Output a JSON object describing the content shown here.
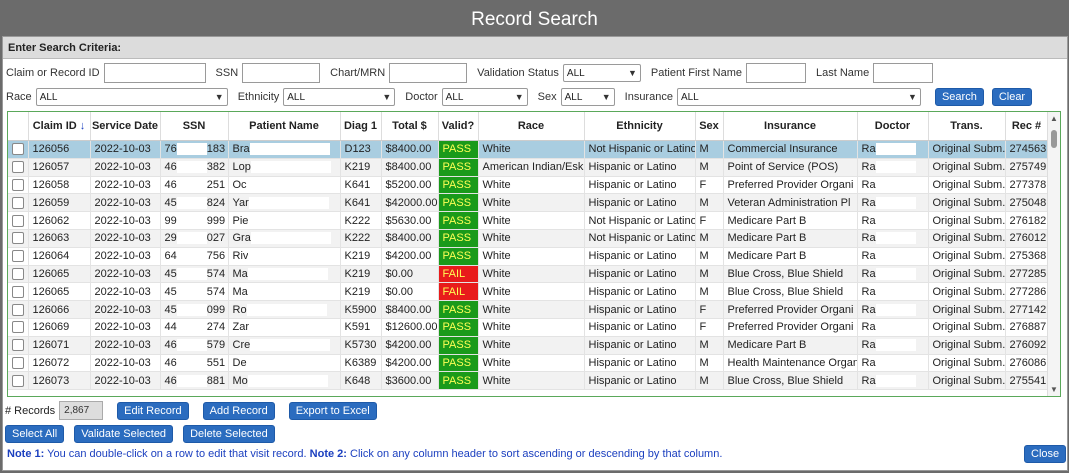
{
  "window": {
    "title": "Record Search"
  },
  "criteria": {
    "header": "Enter Search Criteria:",
    "claim_label": "Claim or Record ID",
    "ssn_label": "SSN",
    "chart_label": "Chart/MRN",
    "validation_label": "Validation Status",
    "validation_value": "ALL",
    "first_name_label": "Patient First Name",
    "last_name_label": "Last Name",
    "race_label": "Race",
    "race_value": "ALL",
    "ethnicity_label": "Ethnicity",
    "ethnicity_value": "ALL",
    "doctor_label": "Doctor",
    "doctor_value": "ALL",
    "sex_label": "Sex",
    "sex_value": "ALL",
    "insurance_label": "Insurance",
    "insurance_value": "ALL",
    "search_button": "Search",
    "clear_button": "Clear"
  },
  "grid": {
    "columns": [
      "",
      "Claim ID",
      "Service Date",
      "SSN",
      "Patient Name",
      "Diag 1",
      "Total $",
      "Valid?",
      "Race",
      "Ethnicity",
      "Sex",
      "Insurance",
      "Doctor",
      "Trans.",
      "Rec #"
    ],
    "sort_arrow": "↓",
    "rows": [
      {
        "claim": "126056",
        "date": "2022-10-03",
        "ssn_a": "76",
        "ssn_b": "183",
        "name": "Bra",
        "diag": "D123",
        "total": "$8400.00",
        "valid": "PASS",
        "race": "White",
        "eth": "Not Hispanic or Latino",
        "sex": "M",
        "ins": "Commercial Insurance",
        "doc": "Ra",
        "trans": "Original Subm.",
        "rec": "274563"
      },
      {
        "claim": "126057",
        "date": "2022-10-03",
        "ssn_a": "46",
        "ssn_b": "382",
        "name": "Lop",
        "diag": "K219",
        "total": "$8400.00",
        "valid": "PASS",
        "race": "American Indian/Eski",
        "eth": "Hispanic or Latino",
        "sex": "M",
        "ins": "Point of Service (POS)",
        "doc": "Ra",
        "trans": "Original Subm.",
        "rec": "275749"
      },
      {
        "claim": "126058",
        "date": "2022-10-03",
        "ssn_a": "46",
        "ssn_b": "251",
        "name": "Oc",
        "diag": "K641",
        "total": "$5200.00",
        "valid": "PASS",
        "race": "White",
        "eth": "Hispanic or Latino",
        "sex": "F",
        "ins": "Preferred Provider Organi",
        "doc": "Ra",
        "trans": "Original Subm.",
        "rec": "277378"
      },
      {
        "claim": "126059",
        "date": "2022-10-03",
        "ssn_a": "45",
        "ssn_b": "824",
        "name": "Yar",
        "diag": "K641",
        "total": "$42000.00",
        "valid": "PASS",
        "race": "White",
        "eth": "Hispanic or Latino",
        "sex": "M",
        "ins": "Veteran Administration Pl",
        "doc": "Ra",
        "trans": "Original Subm.",
        "rec": "275048"
      },
      {
        "claim": "126062",
        "date": "2022-10-03",
        "ssn_a": "99",
        "ssn_b": "999",
        "name": "Pie",
        "diag": "K222",
        "total": "$5630.00",
        "valid": "PASS",
        "race": "White",
        "eth": "Not Hispanic or Latino",
        "sex": "F",
        "ins": "Medicare Part B",
        "doc": "Ra",
        "trans": "Original Subm.",
        "rec": "276182"
      },
      {
        "claim": "126063",
        "date": "2022-10-03",
        "ssn_a": "29",
        "ssn_b": "027",
        "name": "Gra",
        "diag": "K222",
        "total": "$8400.00",
        "valid": "PASS",
        "race": "White",
        "eth": "Not Hispanic or Latino",
        "sex": "M",
        "ins": "Medicare Part B",
        "doc": "Ra",
        "trans": "Original Subm.",
        "rec": "276012"
      },
      {
        "claim": "126064",
        "date": "2022-10-03",
        "ssn_a": "64",
        "ssn_b": "756",
        "name": "Riv",
        "diag": "K219",
        "total": "$4200.00",
        "valid": "PASS",
        "race": "White",
        "eth": "Hispanic or Latino",
        "sex": "M",
        "ins": "Medicare Part B",
        "doc": "Ra",
        "trans": "Original Subm.",
        "rec": "275368"
      },
      {
        "claim": "126065",
        "date": "2022-10-03",
        "ssn_a": "45",
        "ssn_b": "574",
        "name": "Ma",
        "diag": "K219",
        "total": "$0.00",
        "valid": "FAIL",
        "race": "White",
        "eth": "Hispanic or Latino",
        "sex": "M",
        "ins": "Blue Cross, Blue Shield",
        "doc": "Ra",
        "trans": "Original Subm.",
        "rec": "277285"
      },
      {
        "claim": "126065",
        "date": "2022-10-03",
        "ssn_a": "45",
        "ssn_b": "574",
        "name": "Ma",
        "diag": "K219",
        "total": "$0.00",
        "valid": "FAIL",
        "race": "White",
        "eth": "Hispanic or Latino",
        "sex": "M",
        "ins": "Blue Cross, Blue Shield",
        "doc": "Ra",
        "trans": "Original Subm.",
        "rec": "277286"
      },
      {
        "claim": "126066",
        "date": "2022-10-03",
        "ssn_a": "45",
        "ssn_b": "099",
        "name": "Ro",
        "diag": "K5900",
        "total": "$8400.00",
        "valid": "PASS",
        "race": "White",
        "eth": "Hispanic or Latino",
        "sex": "F",
        "ins": "Preferred Provider Organi",
        "doc": "Ra",
        "trans": "Original Subm.",
        "rec": "277142"
      },
      {
        "claim": "126069",
        "date": "2022-10-03",
        "ssn_a": "44",
        "ssn_b": "274",
        "name": "Zar",
        "diag": "K591",
        "total": "$12600.00",
        "valid": "PASS",
        "race": "White",
        "eth": "Hispanic or Latino",
        "sex": "F",
        "ins": "Preferred Provider Organi",
        "doc": "Ra",
        "trans": "Original Subm.",
        "rec": "276887"
      },
      {
        "claim": "126071",
        "date": "2022-10-03",
        "ssn_a": "46",
        "ssn_b": "579",
        "name": "Cre",
        "diag": "K5730",
        "total": "$4200.00",
        "valid": "PASS",
        "race": "White",
        "eth": "Hispanic or Latino",
        "sex": "M",
        "ins": "Medicare Part B",
        "doc": "Ra",
        "trans": "Original Subm.",
        "rec": "276092"
      },
      {
        "claim": "126072",
        "date": "2022-10-03",
        "ssn_a": "46",
        "ssn_b": "551",
        "name": "De",
        "diag": "K6389",
        "total": "$4200.00",
        "valid": "PASS",
        "race": "White",
        "eth": "Hispanic or Latino",
        "sex": "M",
        "ins": "Health Maintenance Organi",
        "doc": "Ra",
        "trans": "Original Subm.",
        "rec": "276086"
      },
      {
        "claim": "126073",
        "date": "2022-10-03",
        "ssn_a": "46",
        "ssn_b": "881",
        "name": "Mo",
        "diag": "K648",
        "total": "$3600.00",
        "valid": "PASS",
        "race": "White",
        "eth": "Hispanic or Latino",
        "sex": "M",
        "ins": "Blue Cross, Blue Shield",
        "doc": "Ra",
        "trans": "Original Subm.",
        "rec": "275541"
      }
    ]
  },
  "footer": {
    "records_label": "# Records",
    "records_count": "2,867",
    "edit_record": "Edit Record",
    "add_record": "Add Record",
    "export_excel": "Export to Excel",
    "select_all": "Select All",
    "validate_selected": "Validate Selected",
    "delete_selected": "Delete Selected",
    "note1_label": "Note 1:",
    "note1_text": "You can double-click on a row to edit that visit record.",
    "note2_label": "Note 2:",
    "note2_text": "Click on any column header to sort ascending or descending by that column.",
    "close_button": "Close"
  },
  "colors": {
    "pass": "#1a9a1a",
    "fail": "#e81b1b",
    "button": "#2b6cbf",
    "selected_row": "#a9cde0",
    "grid_border": "#5aa85a"
  }
}
